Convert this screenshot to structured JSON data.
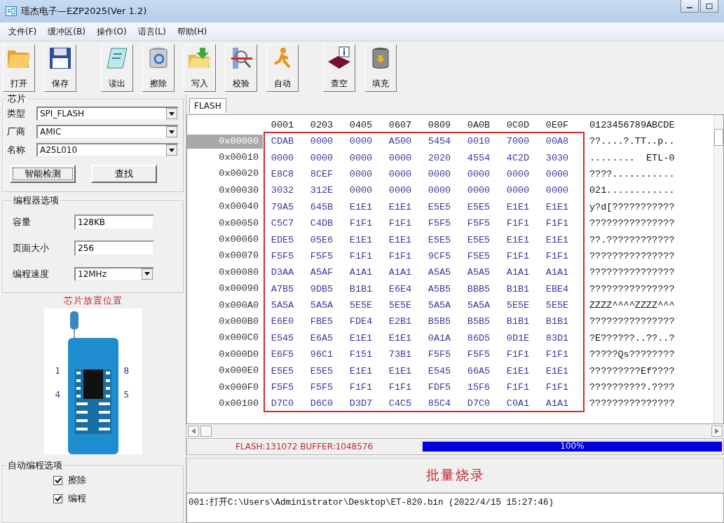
{
  "window": {
    "title": "瑶杰电子—EZP2025(Ver 1.2)"
  },
  "menu": [
    "文件(F)",
    "缓冲区(B)",
    "操作(O)",
    "语言(L)",
    "帮助(H)"
  ],
  "toolbar": [
    {
      "label": "打开",
      "kind": "open"
    },
    {
      "label": "保存",
      "kind": "save"
    },
    {
      "label": "读出",
      "kind": "read"
    },
    {
      "label": "擦除",
      "kind": "erase"
    },
    {
      "label": "写入",
      "kind": "write"
    },
    {
      "label": "校验",
      "kind": "verify"
    },
    {
      "label": "自动",
      "kind": "auto"
    },
    {
      "label": "查空",
      "kind": "blank"
    },
    {
      "label": "填充",
      "kind": "fill"
    }
  ],
  "chip": {
    "title": "芯片",
    "fields": [
      {
        "label": "类型",
        "value": "SPI_FLASH"
      },
      {
        "label": "厂商",
        "value": "AMIC"
      },
      {
        "label": "名称",
        "value": "A25L010"
      }
    ],
    "buttons": [
      {
        "label": "智能检测",
        "focused": true
      },
      {
        "label": "查找",
        "focused": false
      }
    ]
  },
  "programmer": {
    "title": "编程器选项",
    "fields": [
      {
        "label": "容量",
        "value": "128KB",
        "kind": "text"
      },
      {
        "label": "页面大小",
        "value": "256",
        "kind": "text"
      },
      {
        "label": "编程速度",
        "value": "12MHz",
        "kind": "select"
      }
    ]
  },
  "socket": {
    "title": "芯片放置位置",
    "pins": [
      "1",
      "8",
      "4",
      "5"
    ]
  },
  "auto_options": {
    "title": "自动编程选项",
    "items": [
      {
        "label": "擦除",
        "checked": true
      },
      {
        "label": "编程",
        "checked": true
      }
    ]
  },
  "tabs": [
    {
      "label": "FLASH",
      "selected": true
    }
  ],
  "hex": {
    "header": [
      "0001",
      "0203",
      "0405",
      "0607",
      "0809",
      "0A0B",
      "0C0D",
      "0E0F"
    ],
    "ascii_header": "0123456789ABCDE",
    "rows": [
      {
        "address": "0x00000",
        "selected": true,
        "words": [
          "CDAB",
          "0000",
          "0000",
          "A500",
          "5454",
          "0010",
          "7000",
          "00A8"
        ],
        "ascii": "??....?.TT..p.."
      },
      {
        "address": "0x00010",
        "selected": false,
        "words": [
          "0000",
          "0000",
          "0000",
          "0000",
          "2020",
          "4554",
          "4C2D",
          "3030"
        ],
        "ascii": "........  ETL-0"
      },
      {
        "address": "0x00020",
        "selected": false,
        "words": [
          "E8C8",
          "8CEF",
          "0000",
          "0000",
          "0000",
          "0000",
          "0000",
          "0000"
        ],
        "ascii": "????..........."
      },
      {
        "address": "0x00030",
        "selected": false,
        "words": [
          "3032",
          "312E",
          "0000",
          "0000",
          "0000",
          "0000",
          "0000",
          "0000"
        ],
        "ascii": "021............"
      },
      {
        "address": "0x00040",
        "selected": false,
        "words": [
          "79A5",
          "645B",
          "E1E1",
          "E1E1",
          "E5E5",
          "E5E5",
          "E1E1",
          "E1E1"
        ],
        "ascii": "y?d[???????????"
      },
      {
        "address": "0x00050",
        "selected": false,
        "words": [
          "C5C7",
          "C4DB",
          "F1F1",
          "F1F1",
          "F5F5",
          "F5F5",
          "F1F1",
          "F1F1"
        ],
        "ascii": "???????????????"
      },
      {
        "address": "0x00060",
        "selected": false,
        "words": [
          "EDE5",
          "05E6",
          "E1E1",
          "E1E1",
          "E5E5",
          "E5E5",
          "E1E1",
          "E1E1"
        ],
        "ascii": "??.????????????"
      },
      {
        "address": "0x00070",
        "selected": false,
        "words": [
          "F5F5",
          "F5F5",
          "F1F1",
          "F1F1",
          "9CF5",
          "F5E5",
          "F1F1",
          "F1F1"
        ],
        "ascii": "???????????????"
      },
      {
        "address": "0x00080",
        "selected": false,
        "words": [
          "D3AA",
          "A5AF",
          "A1A1",
          "A1A1",
          "A5A5",
          "A5A5",
          "A1A1",
          "A1A1"
        ],
        "ascii": "???????????????"
      },
      {
        "address": "0x00090",
        "selected": false,
        "words": [
          "A7B5",
          "9DB5",
          "B1B1",
          "E6E4",
          "A5B5",
          "BBB5",
          "B1B1",
          "EBE4"
        ],
        "ascii": "???????????????"
      },
      {
        "address": "0x000A0",
        "selected": false,
        "words": [
          "5A5A",
          "5A5A",
          "5E5E",
          "5E5E",
          "5A5A",
          "5A5A",
          "5E5E",
          "5E5E"
        ],
        "ascii": "ZZZZ^^^^ZZZZ^^^"
      },
      {
        "address": "0x000B0",
        "selected": false,
        "words": [
          "E6E0",
          "FBE5",
          "FDE4",
          "E2B1",
          "B5B5",
          "B5B5",
          "B1B1",
          "B1B1"
        ],
        "ascii": "???????????????"
      },
      {
        "address": "0x000C0",
        "selected": false,
        "words": [
          "E545",
          "E6A5",
          "E1E1",
          "E1E1",
          "0A1A",
          "86D5",
          "0D1E",
          "83D1"
        ],
        "ascii": "?E??????..??..?"
      },
      {
        "address": "0x000D0",
        "selected": false,
        "words": [
          "E6F5",
          "96C1",
          "F151",
          "73B1",
          "F5F5",
          "F5F5",
          "F1F1",
          "F1F1"
        ],
        "ascii": "?????Qs????????"
      },
      {
        "address": "0x000E0",
        "selected": false,
        "words": [
          "E5E5",
          "E5E5",
          "E1E1",
          "E1E1",
          "E545",
          "66A5",
          "E1E1",
          "E1E1"
        ],
        "ascii": "?????????Ef????"
      },
      {
        "address": "0x000F0",
        "selected": false,
        "words": [
          "F5F5",
          "F5F5",
          "F1F1",
          "F1F1",
          "FDF5",
          "15F6",
          "F1F1",
          "F1F1"
        ],
        "ascii": "??????????.????"
      },
      {
        "address": "0x00100",
        "selected": false,
        "words": [
          "D7C0",
          "D6C0",
          "D3D7",
          "C4C5",
          "85C4",
          "D7C0",
          "C0A1",
          "A1A1"
        ],
        "ascii": "???????????????"
      }
    ]
  },
  "status": {
    "text": "FLASH:131072 BUFFER:1048576",
    "progress": {
      "level": 1.0,
      "reading": "100%"
    }
  },
  "batch_button": "批量烧录",
  "log": [
    "001:打开C:\\Users\\Administrator\\Desktop\\ET-820.bin (2022/4/15 15:27:46)"
  ]
}
